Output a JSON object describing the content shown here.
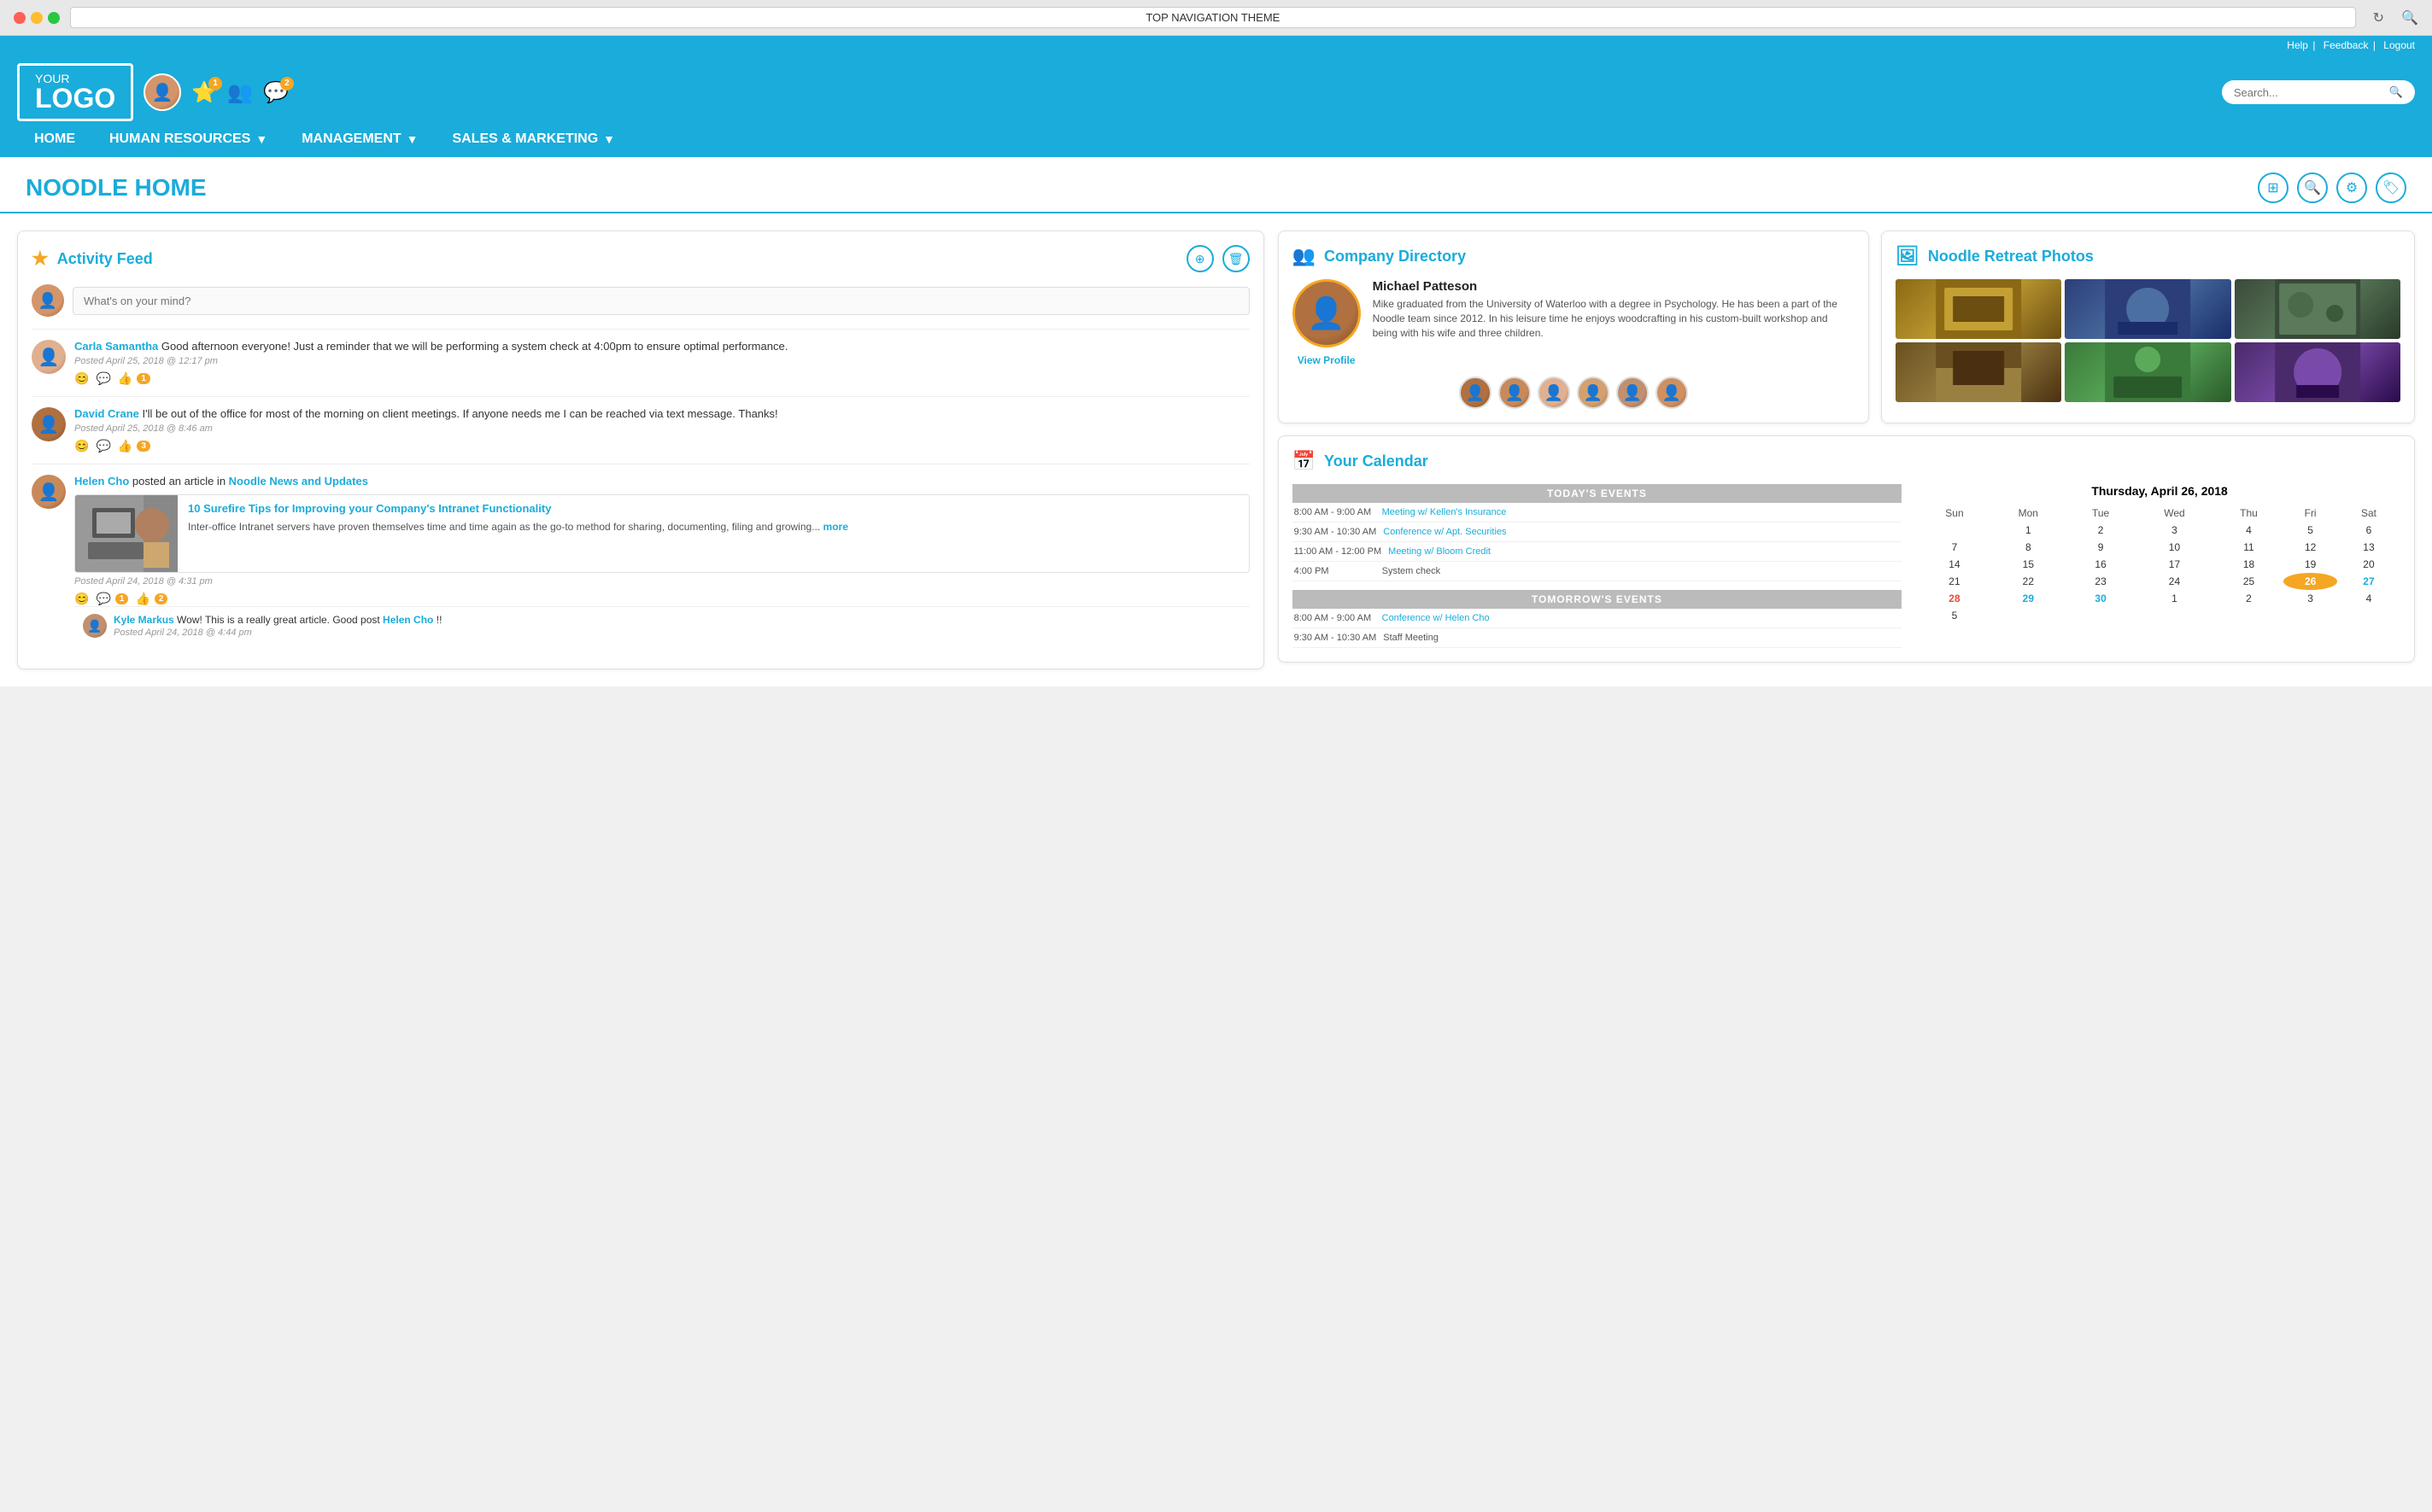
{
  "browser": {
    "title": "TOP NAVIGATION THEME",
    "refresh_icon": "↻",
    "search_icon": "🔍"
  },
  "utility_bar": {
    "help": "Help",
    "separator": "|",
    "feedback": "Feedback",
    "logout": "Logout"
  },
  "header": {
    "logo_your": "YOUR",
    "logo_logo": "LOGO",
    "search_placeholder": "Search...",
    "user_notifications_count": "1",
    "chat_count": "2"
  },
  "nav": {
    "home": "HOME",
    "human_resources": "HUMAN RESOURCES",
    "management": "MANAGEMENT",
    "sales_marketing": "SALES & MARKETING"
  },
  "page": {
    "title": "NOODLE HOME"
  },
  "activity_feed": {
    "title": "Activity Feed",
    "composer_placeholder": "What's on your mind?",
    "posts": [
      {
        "author": "Carla Samantha",
        "text": "Good afternoon everyone! Just a reminder that we will be performing a system check at 4:00pm to ensure optimal performance.",
        "timestamp": "Posted April 25, 2018 @ 12:17 pm",
        "likes": "1"
      },
      {
        "author": "David Crane",
        "text": "I'll be out of the office for most of the morning on client meetings. If anyone needs me I can be reached via text message. Thanks!",
        "timestamp": "Posted April 25, 2018 @ 8:46 am",
        "likes": "3"
      }
    ],
    "article_post": {
      "author": "Helen Cho",
      "posted_in_prefix": "posted an article in",
      "category": "Noodle News and Updates",
      "article_title": "10 Surefire Tips for Improving your Company's Intranet Functionality",
      "excerpt": "Inter-office Intranet servers have proven themselves time and time again as the go-to method for sharing, documenting, filing and growing...",
      "more": "more",
      "timestamp": "Posted April 24, 2018 @ 4:31 pm",
      "likes": "2",
      "like_count_post": "1",
      "comment": {
        "author": "Kyle Markus",
        "text": "Wow! This is a really great article. Good post",
        "mention": "Helen Cho",
        "suffix": "!!",
        "timestamp": "Posted April 24, 2018 @ 4:44 pm"
      }
    }
  },
  "company_directory": {
    "title": "Company Directory",
    "person": {
      "name": "Michael Patteson",
      "bio": "Mike graduated from the University of Waterloo with a degree in Psychology. He has been a part of the Noodle team since 2012. In his leisure time he enjoys woodcrafting in his custom-built workshop and being with his wife and three children.",
      "view_profile": "View Profile"
    }
  },
  "retreat_photos": {
    "title": "Noodle Retreat Photos"
  },
  "calendar": {
    "title": "Your Calendar",
    "month_title": "Thursday, April 26, 2018",
    "today_events_header": "TODAY'S EVENTS",
    "tomorrow_events_header": "TOMORROW'S EVENTS",
    "today_events": [
      {
        "time": "8:00 AM - 9:00 AM",
        "title": "Meeting w/ Kellen's Insurance",
        "linked": true
      },
      {
        "time": "9:30 AM - 10:30 AM",
        "title": "Conference w/ Apt. Securities",
        "linked": true
      },
      {
        "time": "11:00 AM - 12:00 PM",
        "title": "Meeting w/ Bloom Credit",
        "linked": true
      },
      {
        "time": "4:00 PM",
        "title": "System check",
        "linked": false
      }
    ],
    "tomorrow_events": [
      {
        "time": "8:00 AM - 9:00 AM",
        "title": "Conference w/ Helen Cho",
        "linked": true
      },
      {
        "time": "9:30 AM - 10:30 AM",
        "title": "Staff Meeting",
        "linked": false
      }
    ],
    "cal_headers": [
      "Sun",
      "Mon",
      "Tue",
      "Wed",
      "Thu",
      "Fri",
      "Sat"
    ],
    "cal_rows": [
      [
        "",
        "1",
        "2",
        "3",
        "4",
        "5",
        "6",
        "7"
      ],
      [
        "",
        "8",
        "9",
        "10",
        "11",
        "12",
        "13",
        "14"
      ],
      [
        "",
        "15",
        "16",
        "17",
        "18",
        "19",
        "20",
        "21"
      ],
      [
        "",
        "22",
        "23",
        "24",
        "25",
        "26",
        "27",
        "28"
      ],
      [
        "",
        "29",
        "30",
        "1",
        "2",
        "3",
        "4",
        "5"
      ]
    ]
  }
}
